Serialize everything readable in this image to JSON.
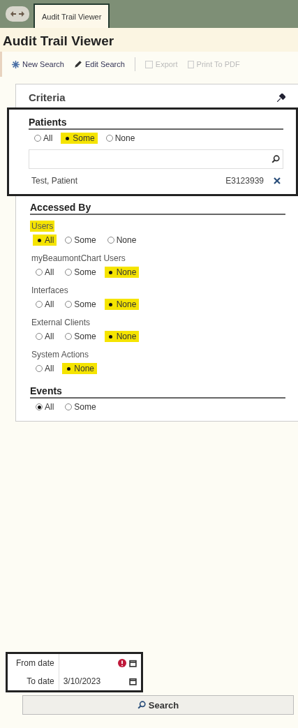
{
  "tabs": [
    {
      "label": "Audit Trail Viewer",
      "selected": true
    }
  ],
  "title": "Audit Trail Viewer",
  "toolbar": [
    {
      "label": "New Search",
      "kind": "new",
      "disabled": false
    },
    {
      "label": "Edit Search",
      "kind": "edit",
      "disabled": false
    },
    {
      "label": "Export",
      "kind": "export",
      "disabled": true
    },
    {
      "label": "Print To PDF",
      "kind": "pdf",
      "disabled": true
    }
  ],
  "criteria": {
    "title": "Criteria",
    "patients": {
      "title": "Patients",
      "options": [
        {
          "label": "All",
          "selected": false,
          "highlighted": false
        },
        {
          "label": "Some",
          "selected": true,
          "highlighted": true
        },
        {
          "label": "None",
          "selected": false,
          "highlighted": false
        }
      ],
      "results": [
        {
          "name": "Test, Patient",
          "mrn": "E3123939"
        }
      ]
    },
    "accessed_by": {
      "title": "Accessed By",
      "groups": [
        {
          "label": "Users",
          "highlighted": true,
          "options": [
            {
              "label": "All",
              "selected": true,
              "highlighted": true
            },
            {
              "label": "Some",
              "selected": false,
              "highlighted": false
            },
            {
              "label": "None",
              "selected": false,
              "highlighted": false
            }
          ]
        },
        {
          "label": "myBeaumontChart Users",
          "highlighted": false,
          "options": [
            {
              "label": "All",
              "selected": false,
              "highlighted": false
            },
            {
              "label": "Some",
              "selected": false,
              "highlighted": false
            },
            {
              "label": "None",
              "selected": true,
              "highlighted": true
            }
          ]
        },
        {
          "label": "Interfaces",
          "highlighted": false,
          "options": [
            {
              "label": "All",
              "selected": false,
              "highlighted": false
            },
            {
              "label": "Some",
              "selected": false,
              "highlighted": false
            },
            {
              "label": "None",
              "selected": true,
              "highlighted": true
            }
          ]
        },
        {
          "label": "External Clients",
          "highlighted": false,
          "options": [
            {
              "label": "All",
              "selected": false,
              "highlighted": false
            },
            {
              "label": "Some",
              "selected": false,
              "highlighted": false
            },
            {
              "label": "None",
              "selected": true,
              "highlighted": true
            }
          ]
        },
        {
          "label": "System Actions",
          "highlighted": false,
          "options": [
            {
              "label": "All",
              "selected": false,
              "highlighted": false
            },
            {
              "label": "None",
              "selected": true,
              "highlighted": true
            }
          ]
        }
      ]
    },
    "events": {
      "title": "Events",
      "options": [
        {
          "label": "All",
          "selected": true,
          "highlighted": false
        },
        {
          "label": "Some",
          "selected": false,
          "highlighted": false
        }
      ]
    }
  },
  "dates": [
    {
      "label": "From date",
      "error": true
    },
    {
      "label": "To date",
      "value": "3/10/2023",
      "error": false
    }
  ],
  "search_button": "Search"
}
